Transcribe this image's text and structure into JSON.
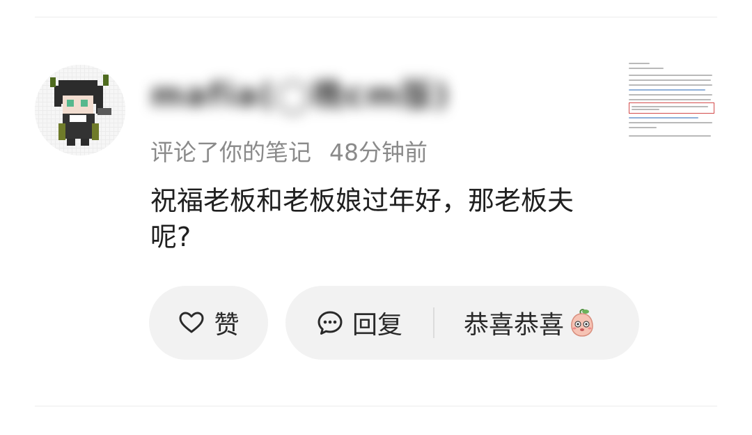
{
  "user": {
    "name": "mafia(◯晚cm版)",
    "avatar_icon": "pixel-character-avatar"
  },
  "notification": {
    "action": "评论了你的笔记",
    "time": "48分钟前"
  },
  "comment": {
    "text": "祝福老板和老板娘过年好，那老板夫呢?"
  },
  "note_thumbnail": {
    "icon": "note-thumbnail-image"
  },
  "actions": {
    "like_label": "赞",
    "reply_label": "回复",
    "quick_reply_label": "恭喜恭喜",
    "like_icon": "heart-outline-icon",
    "reply_icon": "chat-bubble-icon",
    "quick_reply_icon": "peach-emoji-icon"
  },
  "colors": {
    "meta_gray": "#8a8a8a",
    "pill_bg": "#f2f2f2",
    "text": "#1f1f1f"
  }
}
